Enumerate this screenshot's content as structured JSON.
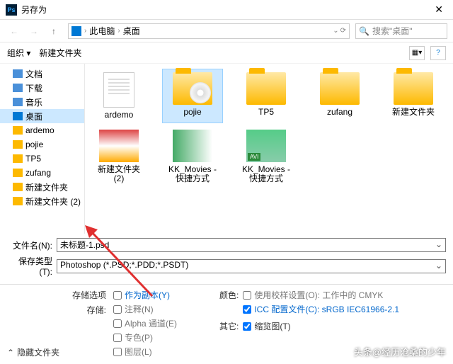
{
  "title": "另存为",
  "path": {
    "root": "此电脑",
    "folder": "桌面"
  },
  "search_placeholder": "搜索\"桌面\"",
  "toolbar": {
    "org": "组织 ▾",
    "newf": "新建文件夹"
  },
  "tree": [
    {
      "label": "文档",
      "icon": "doc"
    },
    {
      "label": "下载",
      "icon": "dl"
    },
    {
      "label": "音乐",
      "icon": "mus"
    },
    {
      "label": "桌面",
      "icon": "dsk",
      "sel": true
    },
    {
      "label": "ardemo",
      "icon": "f"
    },
    {
      "label": "pojie",
      "icon": "f"
    },
    {
      "label": "TP5",
      "icon": "f"
    },
    {
      "label": "zufang",
      "icon": "f"
    },
    {
      "label": "新建文件夹",
      "icon": "f"
    },
    {
      "label": "新建文件夹 (2)",
      "icon": "f"
    }
  ],
  "items": [
    {
      "name": "ardemo",
      "k": "txt"
    },
    {
      "name": "pojie",
      "k": "disc",
      "sel": true
    },
    {
      "name": "TP5",
      "k": "fold"
    },
    {
      "name": "zufang",
      "k": "fold"
    },
    {
      "name": "新建文件夹",
      "k": "fold"
    },
    {
      "name": "新建文件夹 (2)",
      "k": "t1"
    },
    {
      "name": "KK_Movies - 快捷方式",
      "k": "t2"
    },
    {
      "name": "KK_Movies - 快捷方式",
      "k": "t3"
    }
  ],
  "filename_label": "文件名(N):",
  "filename_value": "未标题-1.psd",
  "filetype_label": "保存类型(T):",
  "filetype_value": "Photoshop (*.PSD;*.PDD;*.PSDT)",
  "opts": {
    "head": "存储选项",
    "save": "存储:",
    "copy": "作为副本(Y)",
    "notes": "注释(N)",
    "alpha": "Alpha 通道(E)",
    "spot": "专色(P)",
    "layers": "图层(L)",
    "color": "颜色:",
    "proof": "使用校样设置(O): 工作中的 CMYK",
    "icc": "ICC 配置文件(C): sRGB IEC61966-2.1",
    "other": "其它:",
    "thumb": "缩览图(T)"
  },
  "hide": "隐藏文件夹",
  "watermark": "头条@经历沧桑的少年"
}
